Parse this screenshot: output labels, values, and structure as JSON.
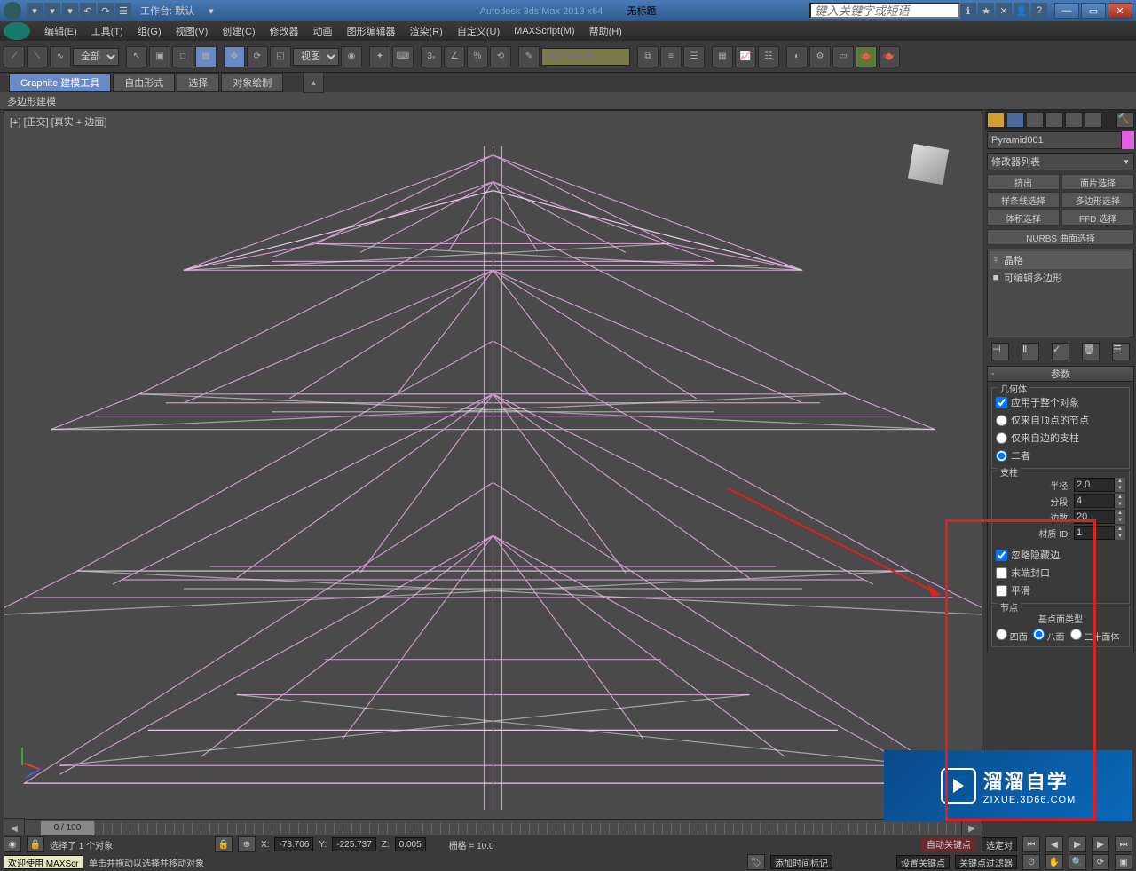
{
  "titlebar": {
    "workspace_label": "工作台: 默认",
    "app_title": "Autodesk 3ds Max  2013 x64",
    "doc_title": "无标题",
    "search_placeholder": "键入关键字或短语"
  },
  "menus": [
    "编辑(E)",
    "工具(T)",
    "组(G)",
    "视图(V)",
    "创建(C)",
    "修改器",
    "动画",
    "图形编辑器",
    "渲染(R)",
    "自定义(U)",
    "MAXScript(M)",
    "帮助(H)"
  ],
  "toolbar": {
    "filter_all": "全部",
    "view_label": "视图",
    "selset_placeholder": "创建选择集"
  },
  "ribbon": {
    "tabs": [
      "Graphite 建模工具",
      "自由形式",
      "选择",
      "对象绘制"
    ],
    "sub": "多边形建模"
  },
  "viewport": {
    "label": "[+] [正交] [真实 + 边面]"
  },
  "side": {
    "obj_name": "Pyramid001",
    "mod_list_label": "修改器列表",
    "sel_buttons": [
      "挤出",
      "面片选择",
      "样条线选择",
      "多边形选择",
      "体积选择",
      "FFD 选择"
    ],
    "nurbs_btn": "NURBS 曲面选择",
    "stack": [
      {
        "icon": "♀",
        "label": "晶格"
      },
      {
        "icon": "■",
        "label": "可编辑多边形"
      }
    ],
    "rollout_title": "参数",
    "grp_geom": "几何体",
    "chk_whole": "应用于整个对象",
    "rad_top": "仅来自顶点的节点",
    "rad_edge": "仅来自边的支柱",
    "rad_both": "二者",
    "grp_strut": "支柱",
    "spin_radius_l": "半径:",
    "spin_radius_v": "2.0",
    "spin_seg_l": "分段:",
    "spin_seg_v": "4",
    "spin_sides_l": "边数:",
    "spin_sides_v": "20",
    "spin_matid_l": "材质 ID:",
    "spin_matid_v": "1",
    "chk_ignhid": "忽略隐藏边",
    "chk_endcap": "末端封口",
    "chk_smooth": "平滑",
    "grp_node": "节点",
    "node_face_label": "基点面类型",
    "rad_quad": "四面",
    "rad_oct": "八面",
    "rad_ico": "二十面体"
  },
  "timeline": {
    "frame": "0 / 100"
  },
  "status": {
    "sel": "选择了 1 个对象",
    "hint": "单击并拖动以选择并移动对象",
    "x_l": "X:",
    "x_v": "-73.706",
    "y_l": "Y:",
    "y_v": "-225.737",
    "z_l": "Z:",
    "z_v": "0.005",
    "grid": "栅格 = 10.0",
    "auto_key": "自动关键点",
    "set_key": "设置关键点",
    "sel_filter": "选定对",
    "key_filter": "关键点过滤器",
    "add_time": "添加时间标记",
    "welcome": "欢迎使用  MAXScr"
  },
  "watermark": {
    "big": "溜溜自学",
    "small": "ZIXUE.3D66.COM"
  }
}
